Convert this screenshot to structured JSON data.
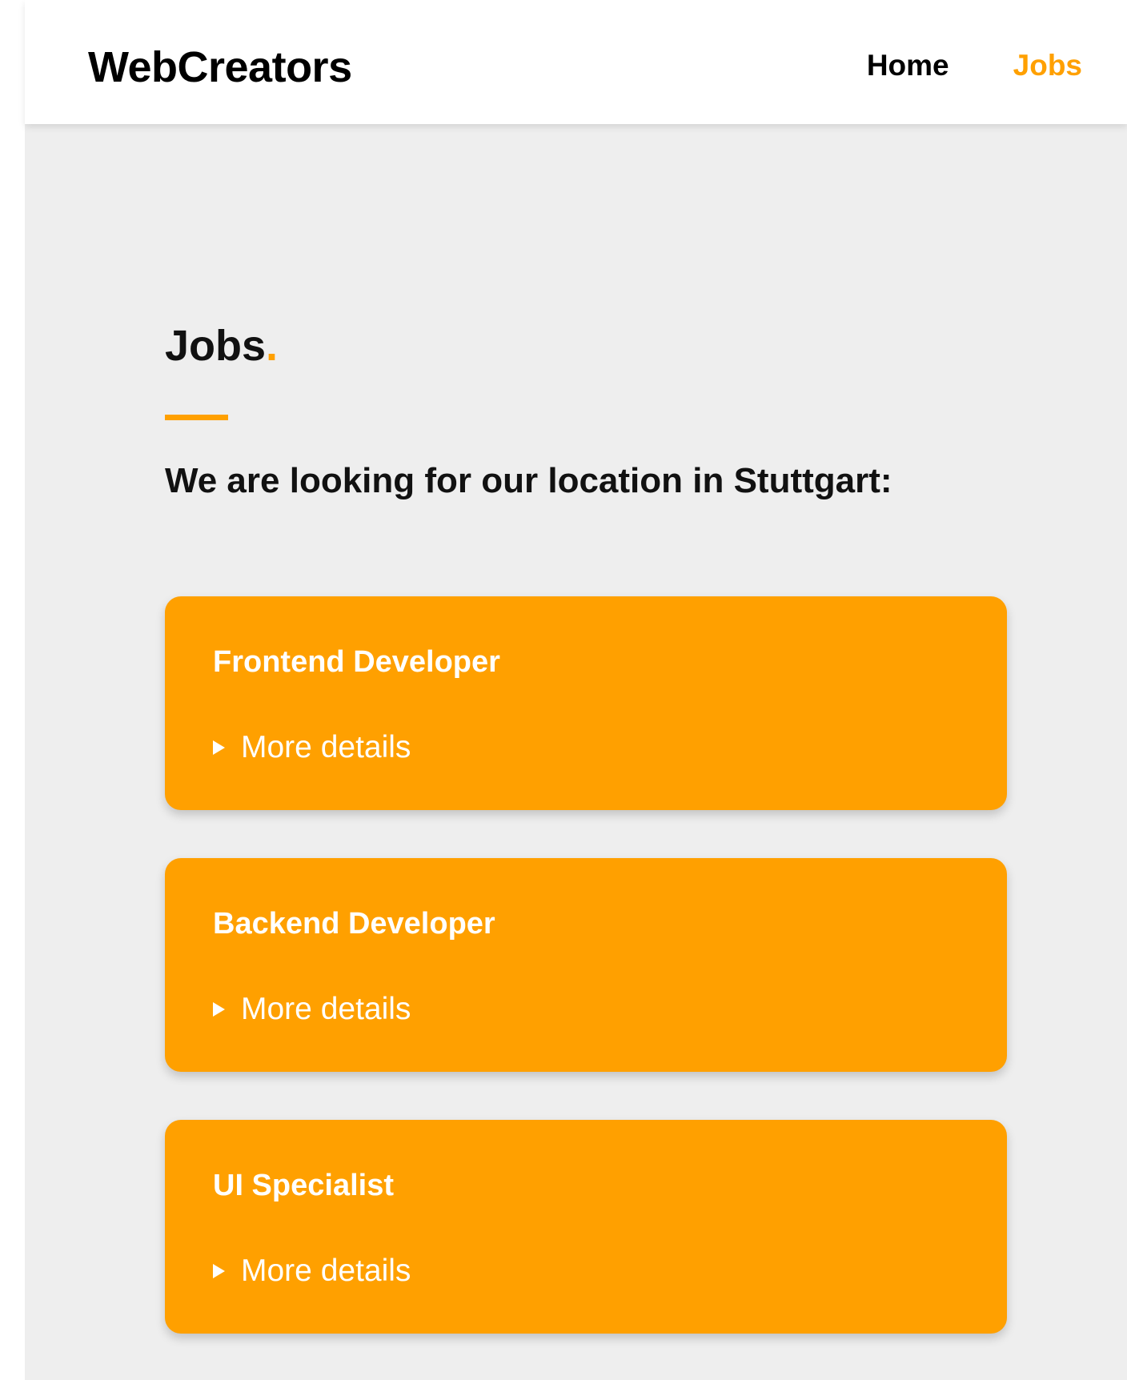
{
  "header": {
    "brand": "WebCreators",
    "nav": {
      "home": "Home",
      "jobs": "Jobs"
    }
  },
  "main": {
    "heading": "Jobs",
    "heading_dot": ".",
    "subtitle": "We are looking for our location in Stuttgart:",
    "jobs": [
      {
        "title": "Frontend Developer",
        "details_label": "More details"
      },
      {
        "title": "Backend Developer",
        "details_label": "More details"
      },
      {
        "title": "UI Specialist",
        "details_label": "More details"
      }
    ]
  },
  "colors": {
    "accent": "#ffa000",
    "background": "#eeeeee",
    "header_background": "#ffffff",
    "text": "#111111"
  },
  "icons": {
    "details_toggle": "caret-right-icon"
  }
}
